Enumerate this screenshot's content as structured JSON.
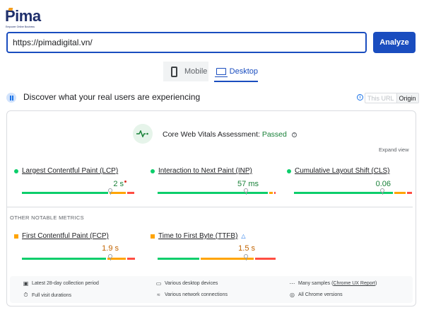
{
  "brand": {
    "logo_text": "Pima",
    "tagline": "Empower Online Business",
    "accent_color": "#f29d1f",
    "brand_color": "#1f2f6b"
  },
  "search": {
    "url_value": "https://pimadigital.vn/",
    "analyze_label": "Analyze"
  },
  "device_tabs": {
    "mobile_label": "Mobile",
    "desktop_label": "Desktop",
    "active": "Desktop"
  },
  "field_data": {
    "title": "Discover what your real users are experiencing",
    "toggle_this_url": "This URL",
    "toggle_origin": "Origin",
    "toggle_active": "Origin"
  },
  "cwv": {
    "title": "Core Web Vitals Assessment:",
    "status": "Passed",
    "expand_label": "Expand view"
  },
  "metrics": [
    {
      "name": "Largest Contentful Paint (LCP)",
      "value": "2 s",
      "status": "good",
      "color": "#188038",
      "marker_fraction": 0.75,
      "distribution": [
        0.75,
        0.14,
        0.06
      ]
    },
    {
      "name": "Interaction to Next Paint (INP)",
      "value": "57 ms",
      "status": "good",
      "color": "#188038",
      "marker_fraction": 0.75,
      "distribution": [
        0.96,
        0.03,
        0.01
      ]
    },
    {
      "name": "Cumulative Layout Shift (CLS)",
      "value": "0.06",
      "status": "good",
      "color": "#188038",
      "marker_fraction": 0.75,
      "distribution": [
        0.86,
        0.1,
        0.04
      ]
    }
  ],
  "other_metrics": {
    "title": "OTHER NOTABLE METRICS",
    "items": [
      {
        "name": "First Contentful Paint (FCP)",
        "value": "1.9 s",
        "status": "needs-improvement",
        "color": "#e37400",
        "marker_fraction": 0.75,
        "distribution": [
          0.73,
          0.16,
          0.07
        ]
      },
      {
        "name": "Time to First Byte (TTFB)",
        "value": "1.5 s",
        "status": "needs-improvement",
        "color": "#e37400",
        "marker_fraction": 0.75,
        "distribution": [
          0.36,
          0.46,
          0.18
        ]
      }
    ]
  },
  "footer": {
    "collection_period": "Latest 28-day collection period",
    "visit_durations": "Full visit durations",
    "devices": "Various desktop devices",
    "connections": "Various network connections",
    "samples_prefix": "Many samples (",
    "samples_link": "Chrome UX Report",
    "samples_suffix": ")",
    "chrome_versions": "All Chrome versions"
  },
  "colors": {
    "primary": "#1a4dbf",
    "good": "#0cce6b",
    "needs_improvement": "#ffa400",
    "poor": "#ff4e42"
  }
}
